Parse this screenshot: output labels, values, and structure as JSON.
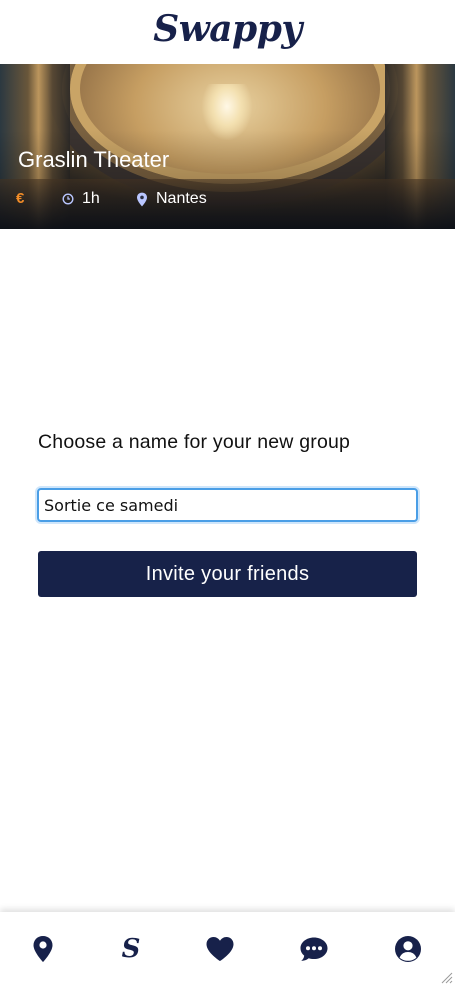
{
  "app": {
    "logo": "Swappy"
  },
  "event": {
    "title": "Graslin Theater",
    "price_symbol": "€",
    "duration": "1h",
    "location": "Nantes"
  },
  "group_form": {
    "prompt": "Choose a name for your new group",
    "input_value": "Sortie ce samedi",
    "submit_label": "Invite your friends"
  },
  "bottom_nav": {
    "s_glyph": "S",
    "items": [
      "map-pin-icon",
      "swappy-s-icon",
      "heart-icon",
      "chat-icon",
      "user-icon"
    ]
  },
  "colors": {
    "brand_navy": "#172249",
    "price_orange": "#f28c28",
    "input_focus": "#4a9ee6"
  }
}
